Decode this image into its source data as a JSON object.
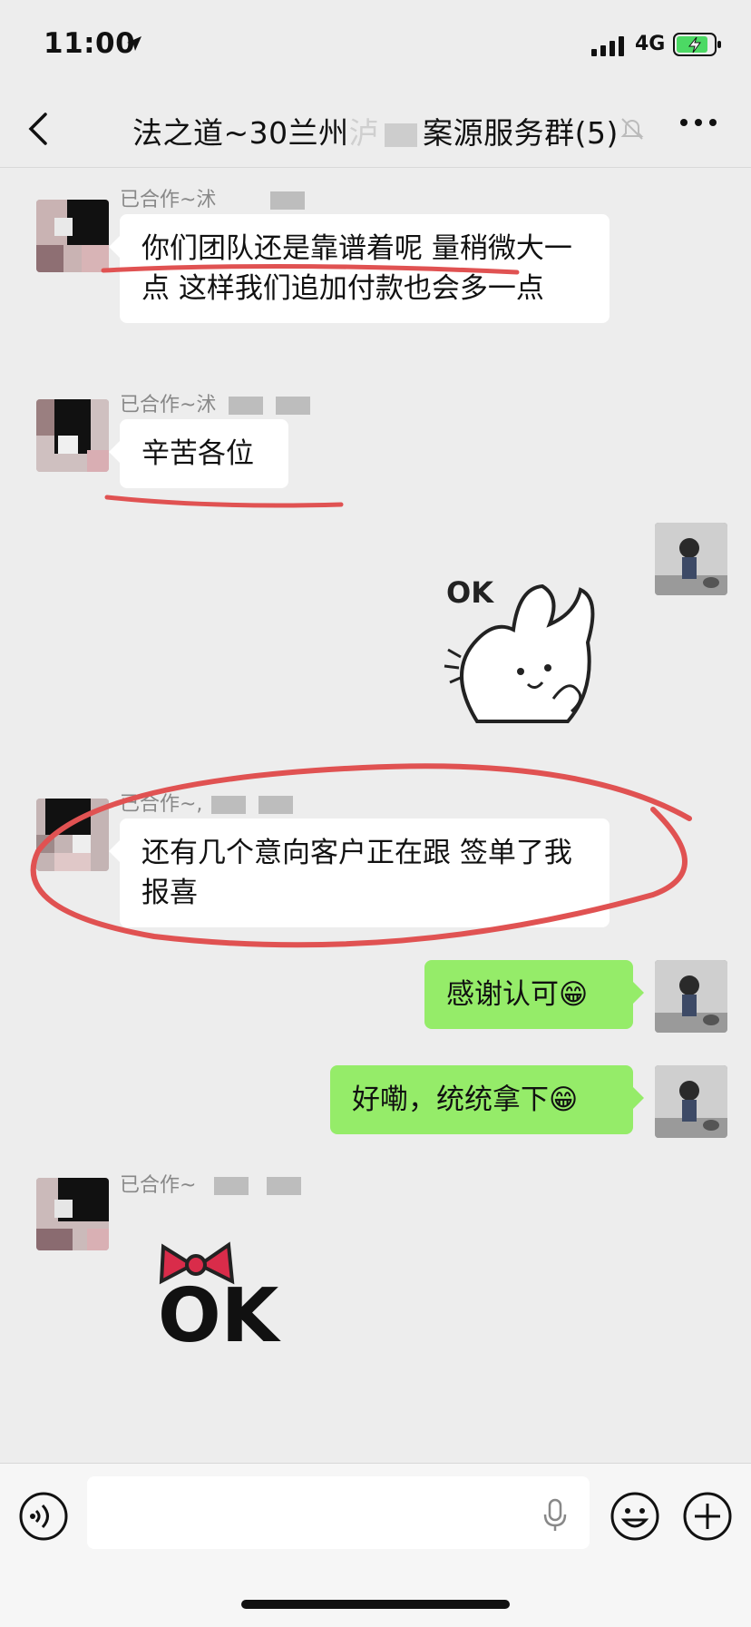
{
  "status_bar": {
    "time": "11:00",
    "network": "4G"
  },
  "header": {
    "title": "法之道~30兰州",
    "title_obscured_fragment": "泸",
    "title_suffix": "案源服务群(5)"
  },
  "messages": [
    {
      "side": "other",
      "sender": "已合作~沭",
      "text": "你们团队还是靠谱着呢 量稍微大一点 这样我们追加付款也会多一点"
    },
    {
      "side": "other",
      "sender": "已合作~沭",
      "text": "辛苦各位"
    },
    {
      "side": "me",
      "sticker_text": "OK"
    },
    {
      "side": "other",
      "sender": "已合作~,",
      "text": "还有几个意向客户正在跟 签单了我报喜"
    },
    {
      "side": "me",
      "text": "感谢认可😁"
    },
    {
      "side": "me",
      "text": "好嘞，统统拿下😁"
    },
    {
      "side": "other",
      "sender": "已合作~",
      "sticker_text": "OK"
    }
  ],
  "input": {
    "placeholder": ""
  },
  "colors": {
    "my_bubble": "#95ec69",
    "annotation_red": "#e05252"
  }
}
